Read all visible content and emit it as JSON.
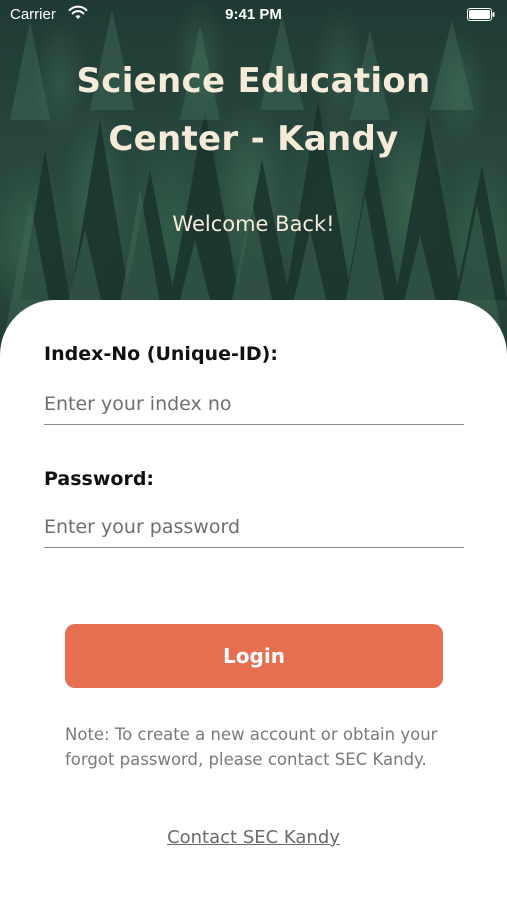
{
  "status_bar": {
    "carrier": "Carrier",
    "time": "9:41 PM"
  },
  "hero": {
    "title_line1": "Science Education",
    "title_line2": "Center - Kandy",
    "subtitle": "Welcome Back!"
  },
  "form": {
    "index_label": "Index-No (Unique-ID):",
    "index_placeholder": "Enter your index no",
    "password_label": "Password:",
    "password_placeholder": "Enter your password",
    "login_label": "Login"
  },
  "note": "Note: To create a new account or obtain your forgot password, please contact SEC Kandy.",
  "contact_link": "Contact SEC Kandy",
  "colors": {
    "accent": "#e56f50",
    "title_text": "#f6ead8",
    "hero_background": "#27463d"
  },
  "icons": {
    "wifi": "wifi-icon",
    "battery": "battery-icon"
  }
}
